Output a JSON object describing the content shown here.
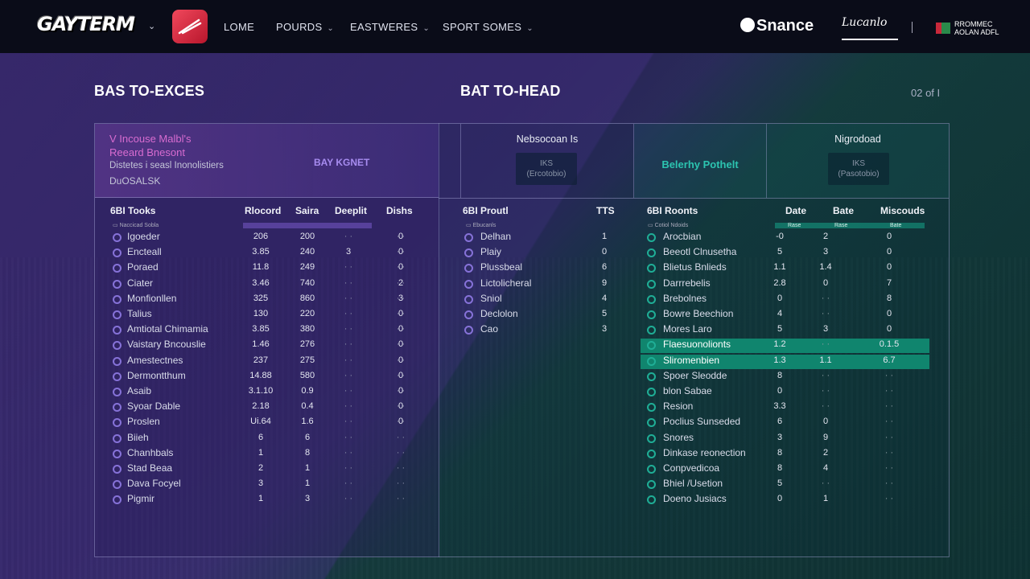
{
  "nav": {
    "logo": "GAYTERM",
    "items": [
      {
        "label": "LOME",
        "caret": false
      },
      {
        "label": "POURDS",
        "caret": true
      },
      {
        "label": "EASTWERES",
        "caret": true
      },
      {
        "label": "SPORT SOMES",
        "caret": true
      }
    ],
    "brand": "Snance",
    "brand2": "Lucanlo",
    "profile_line1": "RROMMEC",
    "profile_line2": "AOLAN ADFL"
  },
  "left": {
    "section_title": "BAS TO-EXCES",
    "header": {
      "line1": "V Incouse Malbl's",
      "line2": "Reeard Bnesont",
      "line3": "Distetes i seasl Inonolistiers",
      "line4": "DuOSALSK",
      "badge": "BAY KGNET"
    },
    "columns": [
      "6BI Tooks",
      "Rlocord",
      "Saira",
      "Deeplit",
      "Dishs"
    ],
    "subheader": "Naccicad Sobla",
    "rows": [
      {
        "name": "Igoeder",
        "v": [
          "206",
          "200",
          "",
          ""
        ],
        "d": "0"
      },
      {
        "name": "Encteall",
        "v": [
          "3.85",
          "240",
          "3",
          ""
        ],
        "d": "0"
      },
      {
        "name": "Poraed",
        "v": [
          "11.8",
          "249",
          "",
          ""
        ],
        "d": "0"
      },
      {
        "name": "Ciater",
        "v": [
          "3.46",
          "740",
          "",
          ""
        ],
        "d": "2"
      },
      {
        "name": "Monfionllen",
        "v": [
          "325",
          "860",
          "",
          ""
        ],
        "d": "3"
      },
      {
        "name": "Talius",
        "v": [
          "130",
          "220",
          "",
          ""
        ],
        "d": "0"
      },
      {
        "name": "Amtiotal Chimamia",
        "v": [
          "3.85",
          "380",
          "",
          ""
        ],
        "d": "0"
      },
      {
        "name": "Vaistary Bncouslie",
        "v": [
          "1.46",
          "276",
          "",
          ""
        ],
        "d": "0"
      },
      {
        "name": "Amestectnes",
        "v": [
          "237",
          "275",
          "",
          ""
        ],
        "d": "0"
      },
      {
        "name": "Dermontthum",
        "v": [
          "14.88",
          "580",
          "",
          ""
        ],
        "d": "0"
      },
      {
        "name": "Asaib",
        "v": [
          "3.1.10",
          "0.9",
          "",
          ""
        ],
        "d": "0"
      },
      {
        "name": "Syoar Dable",
        "v": [
          "2.18",
          "0.4",
          "",
          ""
        ],
        "d": "0"
      },
      {
        "name": "Proslen",
        "v": [
          "Ui.64",
          "1.6",
          "",
          ""
        ],
        "d": "0"
      },
      {
        "name": "Biieh",
        "v": [
          "6",
          "6",
          "",
          ""
        ],
        "d": ""
      },
      {
        "name": "Chanhbals",
        "v": [
          "1",
          "8",
          "",
          ""
        ],
        "d": ""
      },
      {
        "name": "Stad Beaa",
        "v": [
          "2",
          "1",
          "",
          ""
        ],
        "d": ""
      },
      {
        "name": "Dava Focyel",
        "v": [
          "3",
          "1",
          "",
          ""
        ],
        "d": ""
      },
      {
        "name": "Pigmir",
        "v": [
          "1",
          "3",
          "",
          ""
        ],
        "d": ""
      }
    ]
  },
  "right": {
    "section_title": "BAT TO-HEAD",
    "pager": "02 of I",
    "cells": [
      {
        "title": "Nebsocoan Is",
        "box1": "IKS",
        "box2": "(Ercotobio)"
      },
      {
        "mid": "Belerhy Pothelt"
      },
      {
        "title": "Nigrodoad",
        "box1": "IKS",
        "box2": "(Pasotobio)"
      }
    ],
    "mid_columns": [
      "6BI Proutl",
      "TTS"
    ],
    "mid_subheader": "Ebucanls",
    "mid_rows": [
      {
        "name": "Delhan",
        "v": "1"
      },
      {
        "name": "Plaiy",
        "v": "0"
      },
      {
        "name": "Plussbeal",
        "v": "6"
      },
      {
        "name": "Lictolicheral",
        "v": "9"
      },
      {
        "name": "Sniol",
        "v": "4"
      },
      {
        "name": "Declolon",
        "v": "5"
      },
      {
        "name": "Cao",
        "v": "3"
      }
    ],
    "columns": [
      "6BI Roonts",
      "Date",
      "Bate",
      "Miscouds"
    ],
    "subheader": "Cotiol Ndoids",
    "sub_cols": [
      "Rase",
      "Rase",
      "Bate"
    ],
    "rows": [
      {
        "name": "Arocbian",
        "v": [
          "-0",
          "2",
          "0"
        ],
        "hl": false
      },
      {
        "name": "Beeotl Clnusetha",
        "v": [
          "5",
          "3",
          "0"
        ],
        "hl": false
      },
      {
        "name": "Blietus Bnlieds",
        "v": [
          "1.1",
          "1.4",
          "0"
        ],
        "hl": false
      },
      {
        "name": "Darrrebelis",
        "v": [
          "2.8",
          "0",
          "7"
        ],
        "hl": false
      },
      {
        "name": "Brebolnes",
        "v": [
          "0",
          "",
          "8"
        ],
        "hl": false
      },
      {
        "name": "Bowre Beechion",
        "v": [
          "4",
          "",
          "0"
        ],
        "hl": false
      },
      {
        "name": "Mores Laro",
        "v": [
          "5",
          "3",
          "0"
        ],
        "hl": false
      },
      {
        "name": "Flaesuonolionts",
        "v": [
          "1.2",
          "",
          "0.1.5"
        ],
        "hl": true
      },
      {
        "name": "Sliromenbien",
        "v": [
          "1.3",
          "1.1",
          "6.7"
        ],
        "hl": true
      },
      {
        "name": "Spoer Sleodde",
        "v": [
          "8",
          "",
          ""
        ],
        "hl": false
      },
      {
        "name": "blon Sabae",
        "v": [
          "0",
          "",
          ""
        ],
        "hl": false
      },
      {
        "name": "Resion",
        "v": [
          "3.3",
          "",
          ""
        ],
        "hl": false
      },
      {
        "name": "Poclius Sunseded",
        "v": [
          "6",
          "0",
          ""
        ],
        "hl": false
      },
      {
        "name": "Snores",
        "v": [
          "3",
          "9",
          ""
        ],
        "hl": false
      },
      {
        "name": "Dinkase reonection",
        "v": [
          "8",
          "2",
          ""
        ],
        "hl": false
      },
      {
        "name": "Conpvedicoa",
        "v": [
          "8",
          "4",
          ""
        ],
        "hl": false
      },
      {
        "name": "Bhiel /Usetion",
        "v": [
          "5",
          "",
          ""
        ],
        "hl": false
      },
      {
        "name": "Doeno Jusiacs",
        "v": [
          "0",
          "1",
          ""
        ],
        "hl": false
      }
    ]
  },
  "colors": {
    "accent_purple": "#8672d8",
    "accent_teal": "#1fae96",
    "highlight": "#10856e",
    "logo_pink": "#d86cd0"
  }
}
